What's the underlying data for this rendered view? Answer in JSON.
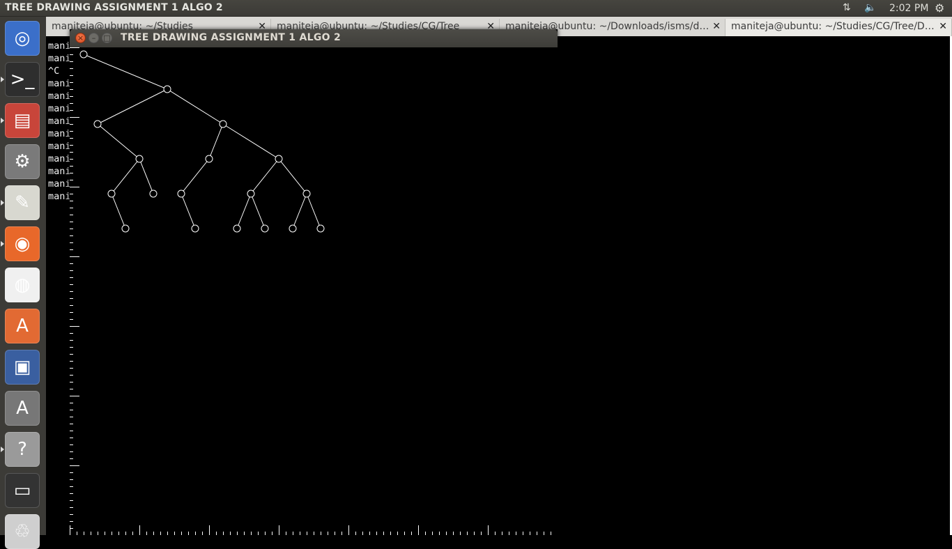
{
  "top_panel": {
    "app_title": "TREE DRAWING ASSIGNMENT 1 ALGO 2",
    "clock": "2:02 PM",
    "network_icon": "network-updown-icon",
    "volume_icon": "volume-icon",
    "session_icon": "gear-icon"
  },
  "launcher": {
    "items": [
      {
        "name": "ubuntu-dash-icon",
        "glyph": "◎",
        "color": "#3b6fc9"
      },
      {
        "name": "terminal-icon",
        "glyph": ">_",
        "color": "#2e2e2e"
      },
      {
        "name": "files-icon",
        "glyph": "▤",
        "color": "#c8453a"
      },
      {
        "name": "system-settings-icon",
        "glyph": "⚙",
        "color": "#7a7a7a"
      },
      {
        "name": "text-editor-icon",
        "glyph": "✎",
        "color": "#d8d8d0"
      },
      {
        "name": "firefox-icon",
        "glyph": "◉",
        "color": "#e8682a"
      },
      {
        "name": "chrome-icon",
        "glyph": "◍",
        "color": "#f0f0f0"
      },
      {
        "name": "software-center-icon",
        "glyph": "A",
        "color": "#e26a33"
      },
      {
        "name": "remote-desktop-icon",
        "glyph": "▣",
        "color": "#3a5fa0"
      },
      {
        "name": "software-updater-icon",
        "glyph": "A",
        "color": "#777"
      },
      {
        "name": "help-icon",
        "glyph": "?",
        "color": "#9a9a9a"
      },
      {
        "name": "save-disk-icon",
        "glyph": "▭",
        "color": "#333"
      },
      {
        "name": "trash-icon",
        "glyph": "♲",
        "color": "#cfcfcf"
      }
    ]
  },
  "terminal": {
    "tabs": [
      {
        "label": "maniteja@ubuntu: ~/Studies"
      },
      {
        "label": "maniteja@ubuntu: ~/Studies/CG/Tree"
      },
      {
        "label": "maniteja@ubuntu: ~/Downloads/isms/d…"
      },
      {
        "label": "maniteja@ubuntu: ~/Studies/CG/Tree/D…"
      }
    ],
    "tab_close_glyph": "✕",
    "lines": [
      "mani",
      "mani",
      "^C",
      "mani",
      "mani",
      "mani",
      "mani",
      "mani",
      "mani",
      "mani",
      "mani",
      "mani",
      "mani"
    ]
  },
  "graphics_window": {
    "title": "TREE DRAWING ASSIGNMENT 1 ALGO 2",
    "close_glyph": "×",
    "min_glyph": "–",
    "max_glyph": "□",
    "tree": {
      "line_color": "#ffffff",
      "nodes": [
        {
          "id": "n0",
          "col": 1,
          "depth": 0
        },
        {
          "id": "n1",
          "col": 7,
          "depth": 1
        },
        {
          "id": "n2",
          "col": 2,
          "depth": 2
        },
        {
          "id": "n3",
          "col": 11,
          "depth": 2
        },
        {
          "id": "n4",
          "col": 5,
          "depth": 3
        },
        {
          "id": "n5",
          "col": 10,
          "depth": 3
        },
        {
          "id": "n6",
          "col": 15,
          "depth": 3
        },
        {
          "id": "n7",
          "col": 3,
          "depth": 4
        },
        {
          "id": "n8",
          "col": 6,
          "depth": 4
        },
        {
          "id": "n9",
          "col": 8,
          "depth": 4
        },
        {
          "id": "n10",
          "col": 13,
          "depth": 4
        },
        {
          "id": "n11",
          "col": 17,
          "depth": 4
        },
        {
          "id": "n12",
          "col": 4,
          "depth": 5
        },
        {
          "id": "n13",
          "col": 9,
          "depth": 5
        },
        {
          "id": "n14",
          "col": 12,
          "depth": 5
        },
        {
          "id": "n15",
          "col": 14,
          "depth": 5
        },
        {
          "id": "n16",
          "col": 16,
          "depth": 5
        },
        {
          "id": "n17",
          "col": 18,
          "depth": 5
        }
      ],
      "edges": [
        [
          "n0",
          "n1"
        ],
        [
          "n1",
          "n2"
        ],
        [
          "n1",
          "n3"
        ],
        [
          "n2",
          "n4"
        ],
        [
          "n3",
          "n5"
        ],
        [
          "n3",
          "n6"
        ],
        [
          "n4",
          "n7"
        ],
        [
          "n4",
          "n8"
        ],
        [
          "n5",
          "n9"
        ],
        [
          "n6",
          "n10"
        ],
        [
          "n6",
          "n11"
        ],
        [
          "n7",
          "n12"
        ],
        [
          "n9",
          "n13"
        ],
        [
          "n10",
          "n14"
        ],
        [
          "n10",
          "n15"
        ],
        [
          "n11",
          "n16"
        ],
        [
          "n11",
          "n17"
        ]
      ]
    }
  }
}
